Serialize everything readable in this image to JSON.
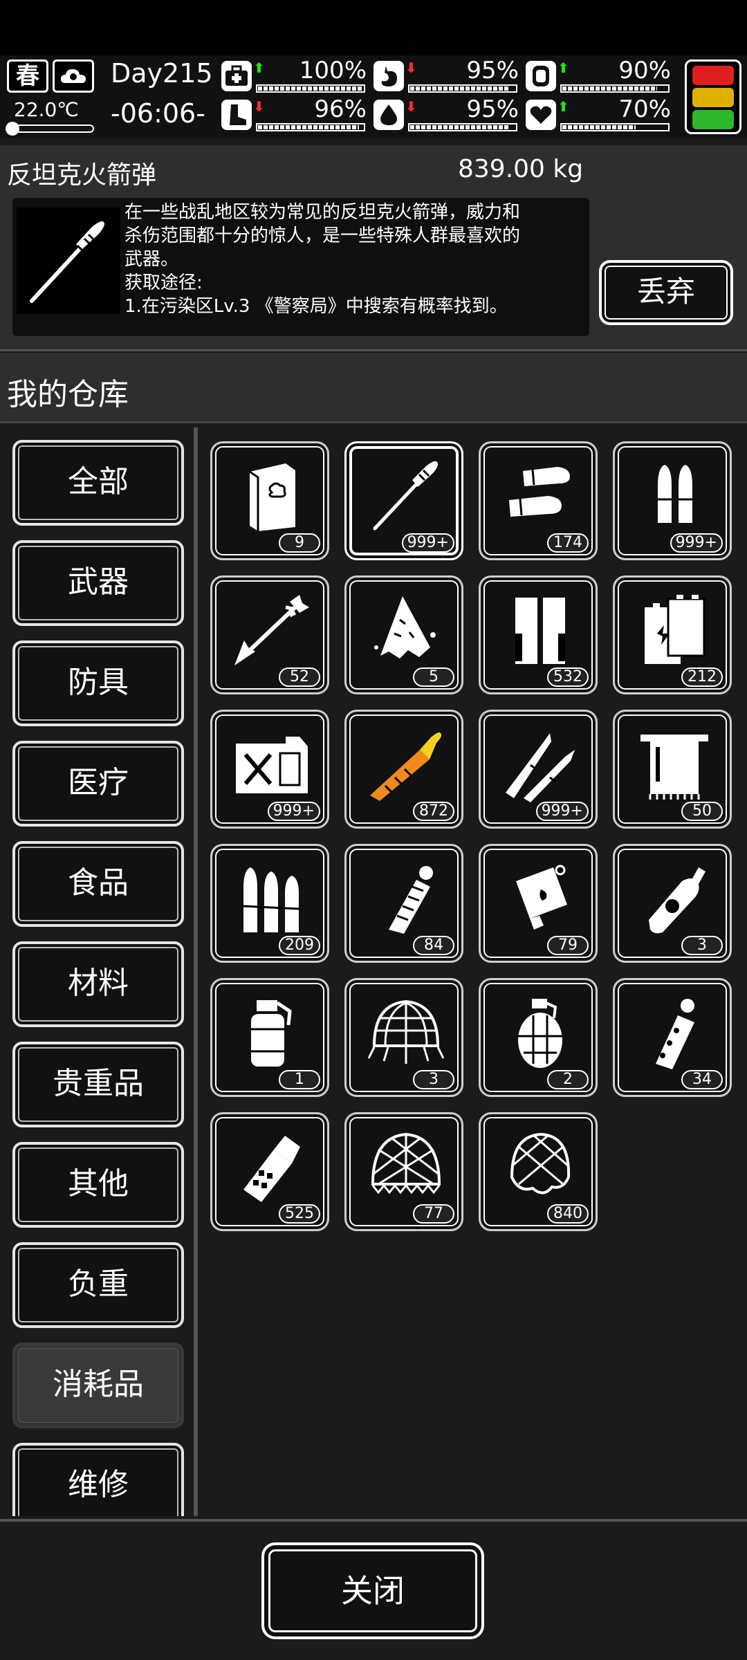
{
  "hud": {
    "season": "春",
    "temperature": "22.0℃",
    "day": "Day215",
    "time": "-06:06-",
    "stats": [
      {
        "name": "health",
        "icon": "medkit-icon",
        "value": "100%",
        "trend": "up",
        "level": 1.0
      },
      {
        "name": "hunger",
        "icon": "stomach-icon",
        "value": "95%",
        "trend": "down",
        "level": 0.95
      },
      {
        "name": "armor",
        "icon": "vest-icon",
        "value": "90%",
        "trend": "up",
        "level": 0.9
      },
      {
        "name": "stamina",
        "icon": "boot-icon",
        "value": "96%",
        "trend": "down",
        "level": 0.96
      },
      {
        "name": "thirst",
        "icon": "water-drop-icon",
        "value": "95%",
        "trend": "down",
        "level": 0.95
      },
      {
        "name": "mood",
        "icon": "heart-icon",
        "value": "70%",
        "trend": "up",
        "level": 0.7
      }
    ],
    "alert_colors": [
      "#e02020",
      "#e0b000",
      "#2cb72c"
    ]
  },
  "detail": {
    "name": "反坦克火箭弹",
    "weight": "839.00 kg",
    "description_lines": [
      "在一些战乱地区较为常见的反坦克火箭弹，威力和",
      "杀伤范围都十分的惊人，是一些特殊人群最喜欢的",
      "武器。",
      "获取途径:",
      "1.在污染区Lv.3 《警察局》中搜索有概率找到。"
    ],
    "discard_label": "丢弃"
  },
  "warehouse_title": "我的仓库",
  "categories": [
    {
      "label": "全部",
      "active": false
    },
    {
      "label": "武器",
      "active": false
    },
    {
      "label": "防具",
      "active": false
    },
    {
      "label": "医疗",
      "active": false
    },
    {
      "label": "食品",
      "active": false
    },
    {
      "label": "材料",
      "active": false
    },
    {
      "label": "贵重品",
      "active": false
    },
    {
      "label": "其他",
      "active": false
    },
    {
      "label": "负重",
      "active": false
    },
    {
      "label": "消耗品",
      "active": true
    },
    {
      "label": "维修",
      "active": false
    }
  ],
  "items": [
    {
      "icon": "book-icon",
      "count": "9"
    },
    {
      "icon": "rocket-icon",
      "count": "999+",
      "selected": true
    },
    {
      "icon": "shotgun-shells-icon",
      "count": "174"
    },
    {
      "icon": "pistol-bullets-icon",
      "count": "999+"
    },
    {
      "icon": "arrow-icon",
      "count": "52"
    },
    {
      "icon": "shard-icon",
      "count": "5"
    },
    {
      "icon": "magazine-icon",
      "count": "532"
    },
    {
      "icon": "battery-icon",
      "count": "212"
    },
    {
      "icon": "fuel-can-icon",
      "count": "999+"
    },
    {
      "icon": "orange-shell-icon",
      "count": "872"
    },
    {
      "icon": "rifle-rounds-icon",
      "count": "999+"
    },
    {
      "icon": "towel-icon",
      "count": "50"
    },
    {
      "icon": "ammo-belt-icon",
      "count": "209"
    },
    {
      "icon": "stick-grenade-icon",
      "count": "84"
    },
    {
      "icon": "incendiary-grenade-icon",
      "count": "79"
    },
    {
      "icon": "gas-canister-icon",
      "count": "3"
    },
    {
      "icon": "smoke-grenade-icon",
      "count": "1"
    },
    {
      "icon": "net-trap-icon",
      "count": "3"
    },
    {
      "icon": "frag-grenade-icon",
      "count": "2"
    },
    {
      "icon": "flashbang-icon",
      "count": "34"
    },
    {
      "icon": "grenade-canister-icon",
      "count": "525"
    },
    {
      "icon": "net-icon",
      "count": "77"
    },
    {
      "icon": "net-bag-icon",
      "count": "840"
    }
  ],
  "close_label": "关闭"
}
